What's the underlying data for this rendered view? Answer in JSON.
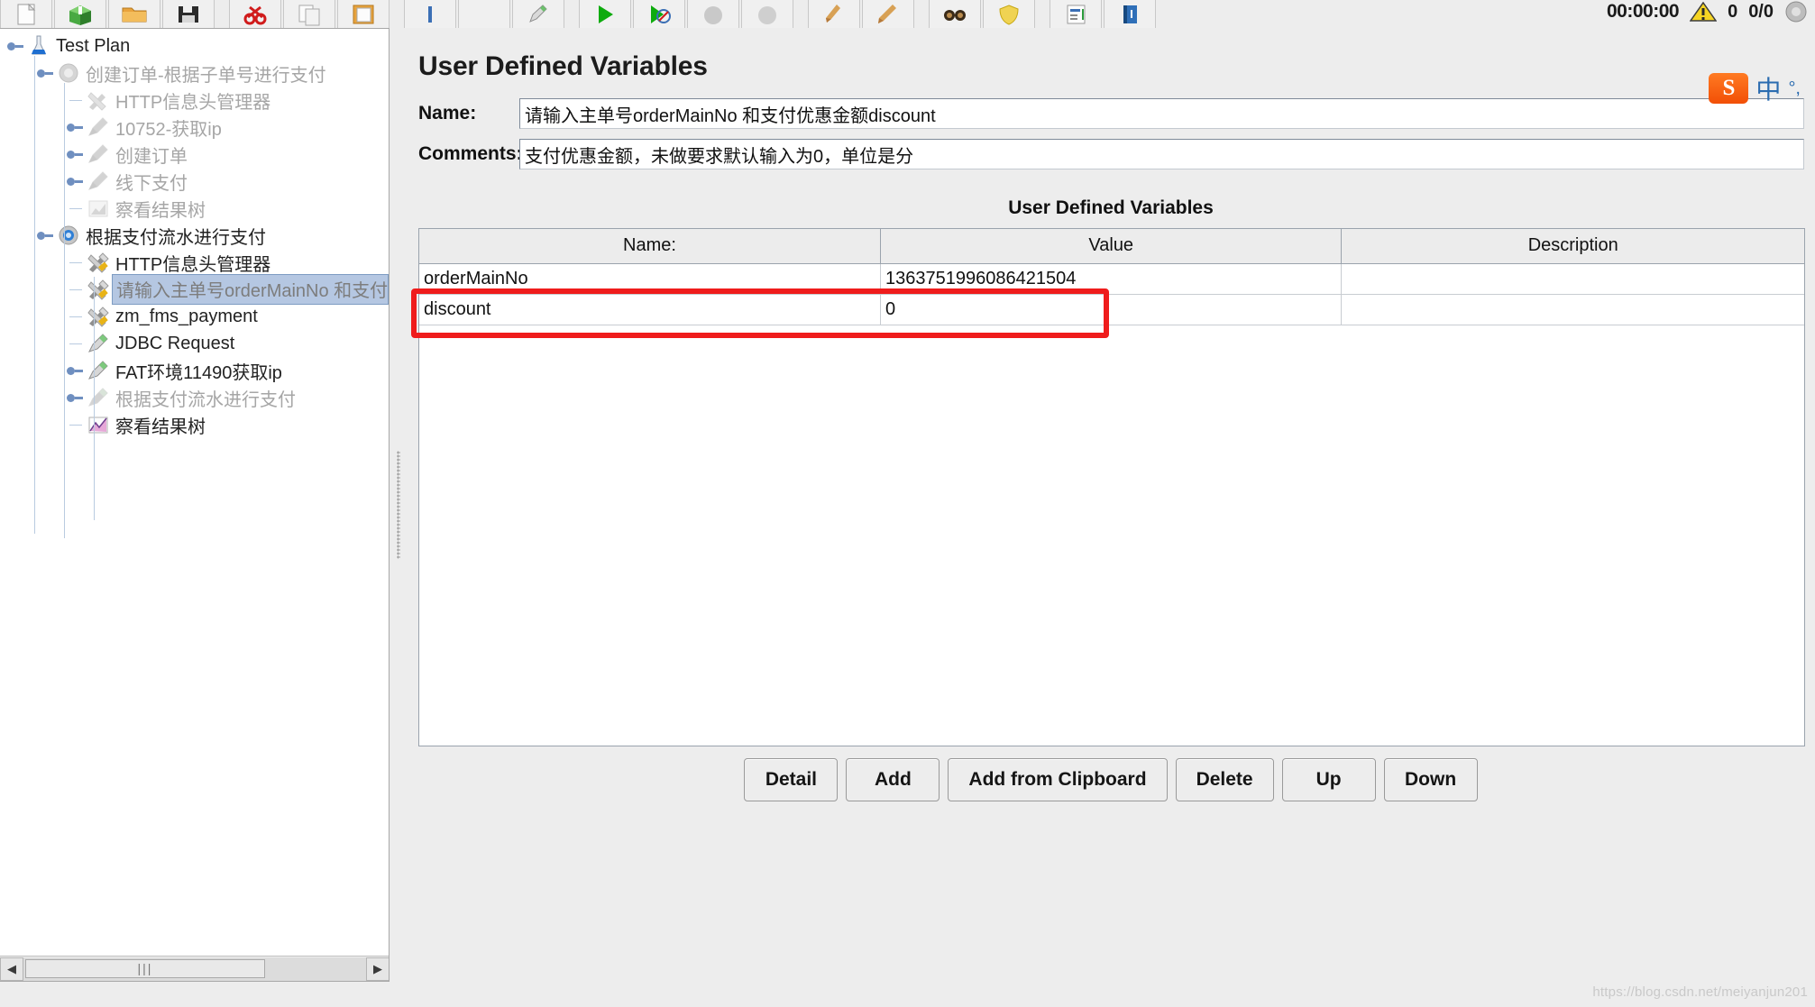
{
  "toolbar": {
    "buttons": [
      {
        "name": "new-test-plan",
        "icon": "new-document-icon"
      },
      {
        "name": "templates",
        "icon": "green-box-icon"
      },
      {
        "name": "open",
        "icon": "folder-icon"
      },
      {
        "name": "save-test-plan",
        "icon": "floppy-disk-icon"
      },
      {
        "name": "cut",
        "icon": "scissors-icon"
      },
      {
        "name": "copy",
        "icon": "copy-pages-icon"
      },
      {
        "name": "paste",
        "icon": "clipboard-paste-icon"
      },
      {
        "name": "expand-all",
        "icon": "expand-icon"
      },
      {
        "name": "collapse-all",
        "icon": "collapse-icon"
      },
      {
        "name": "toggle",
        "icon": "pencil-toggle-icon"
      },
      {
        "name": "start",
        "icon": "green-play-icon"
      },
      {
        "name": "start-no-pauses",
        "icon": "play-no-pause-icon"
      },
      {
        "name": "stop",
        "icon": "stop-icon"
      },
      {
        "name": "shutdown",
        "icon": "shutdown-icon"
      },
      {
        "name": "clear",
        "icon": "broom-icon"
      },
      {
        "name": "clear-all",
        "icon": "broom-all-icon"
      },
      {
        "name": "search",
        "icon": "binoculars-icon"
      },
      {
        "name": "reset-search",
        "icon": "shield-icon"
      },
      {
        "name": "function-helper",
        "icon": "function-list-icon"
      },
      {
        "name": "help",
        "icon": "help-book-icon"
      }
    ]
  },
  "status": {
    "clock": "00:00:00",
    "warn_icon": "warning-triangle-icon",
    "warn_count": "0",
    "thread_ratio": "0/0",
    "active_icon": "gray-gauge-icon"
  },
  "tree": {
    "nodes": [
      {
        "label": "Test Plan",
        "icon": "test-plan-icon",
        "indent": 0,
        "disabled": false,
        "selected": false,
        "knob": "handle"
      },
      {
        "label": "创建订单-根据子单号进行支付",
        "icon": "thread-group-icon",
        "indent": 1,
        "disabled": true,
        "selected": false,
        "knob": "handle"
      },
      {
        "label": "HTTP信息头管理器",
        "icon": "header-manager-icon",
        "indent": 2,
        "disabled": true,
        "selected": false,
        "knob": "elbow"
      },
      {
        "label": "10752-获取ip",
        "icon": "sampler-icon",
        "indent": 2,
        "disabled": true,
        "selected": false,
        "knob": "handle"
      },
      {
        "label": "创建订单",
        "icon": "sampler-icon",
        "indent": 2,
        "disabled": true,
        "selected": false,
        "knob": "handle"
      },
      {
        "label": "线下支付",
        "icon": "sampler-icon",
        "indent": 2,
        "disabled": true,
        "selected": false,
        "knob": "handle"
      },
      {
        "label": "察看结果树",
        "icon": "view-results-tree-icon",
        "indent": 2,
        "disabled": true,
        "selected": false,
        "knob": "elbow"
      },
      {
        "label": "根据支付流水进行支付",
        "icon": "thread-group-active-icon",
        "indent": 1,
        "disabled": false,
        "selected": false,
        "knob": "handle"
      },
      {
        "label": "HTTP信息头管理器",
        "icon": "header-manager-active-icon",
        "indent": 2,
        "disabled": false,
        "selected": false,
        "knob": "elbow"
      },
      {
        "label": "请输入主单号orderMainNo 和支付优",
        "icon": "header-manager-active-icon",
        "indent": 2,
        "disabled": true,
        "selected": true,
        "knob": "elbow"
      },
      {
        "label": "zm_fms_payment",
        "icon": "header-manager-active-icon",
        "indent": 2,
        "disabled": false,
        "selected": false,
        "knob": "elbow"
      },
      {
        "label": "JDBC Request",
        "icon": "jdbc-request-icon",
        "indent": 2,
        "disabled": false,
        "selected": false,
        "knob": "elbow"
      },
      {
        "label": "FAT环境11490获取ip",
        "icon": "jdbc-request-icon",
        "indent": 2,
        "disabled": false,
        "selected": false,
        "knob": "handle"
      },
      {
        "label": "根据支付流水进行支付",
        "icon": "jdbc-request-icon",
        "indent": 2,
        "disabled": true,
        "selected": false,
        "knob": "handle"
      },
      {
        "label": "察看结果树",
        "icon": "view-results-tree-active-icon",
        "indent": 2,
        "disabled": false,
        "selected": false,
        "knob": "elbow"
      }
    ],
    "scrollbar": {
      "left_arrow": "◀",
      "right_arrow": "▶",
      "thumb_grip": "|||"
    }
  },
  "panel": {
    "title": "User Defined Variables",
    "name_label": "Name:",
    "name_value": "请输入主单号orderMainNo 和支付优惠金额discount",
    "comments_label": "Comments:",
    "comments_value": "支付优惠金额，未做要求默认输入为0，单位是分",
    "table_heading": "User Defined Variables",
    "columns": [
      "Name:",
      "Value",
      "Description"
    ],
    "rows": [
      [
        "orderMainNo",
        "1363751996086421504",
        ""
      ],
      [
        "discount",
        "0",
        ""
      ]
    ],
    "buttons": [
      "Detail",
      "Add",
      "Add from Clipboard",
      "Delete",
      "Up",
      "Down"
    ]
  },
  "annotation": {
    "color": "#ef1c1c",
    "target": "discount-row-highlight"
  },
  "ime": {
    "logo_text": "S",
    "mode": "中",
    "dot": "°,"
  },
  "watermark": "https://blog.csdn.net/meiyanjun201"
}
